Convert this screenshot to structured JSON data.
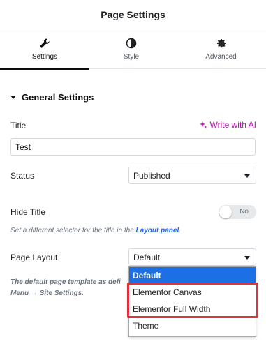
{
  "header": {
    "title": "Page Settings"
  },
  "tabs": [
    {
      "label": "Settings",
      "icon": "wrench-icon",
      "active": true
    },
    {
      "label": "Style",
      "icon": "half-circle-icon",
      "active": false
    },
    {
      "label": "Advanced",
      "icon": "gear-icon",
      "active": false
    }
  ],
  "section": {
    "title": "General Settings"
  },
  "title_field": {
    "label": "Title",
    "ai_link": "Write with AI",
    "value": "Test"
  },
  "status_field": {
    "label": "Status",
    "value": "Published"
  },
  "hide_title": {
    "label": "Hide Title",
    "toggle_text": "No",
    "enabled": false,
    "help_prefix": "Set a different selector for the title in the ",
    "help_link": "Layout panel",
    "help_suffix": "."
  },
  "page_layout": {
    "label": "Page Layout",
    "value": "Default",
    "options": [
      "Default",
      "Elementor Canvas",
      "Elementor Full Width",
      "Theme"
    ],
    "help_line1": "The default page template as defi",
    "help_line2": "Menu → Site Settings."
  },
  "colors": {
    "accent_ai": "#c00bb9",
    "link": "#2563eb",
    "selected_option": "#1d6fe5",
    "highlight": "#e0323c"
  }
}
